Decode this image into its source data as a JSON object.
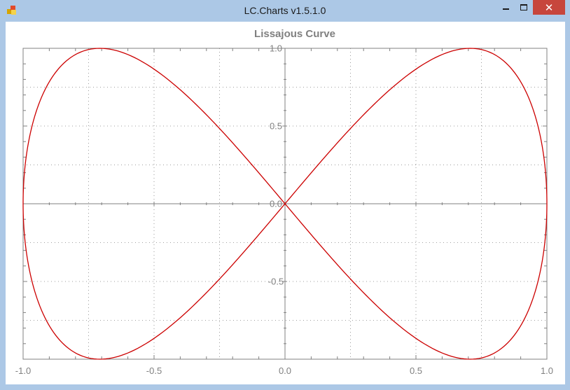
{
  "window": {
    "title": "LC.Charts v1.5.1.0",
    "icon": "app-icon",
    "controls": {
      "minimize": "minimize-icon",
      "maximize": "maximize-icon",
      "close": "close-icon"
    }
  },
  "colors": {
    "titlebar": "#acc8e6",
    "close_button": "#c7463c",
    "curve": "#cc0000",
    "axis": "#808080",
    "grid": "#808080",
    "text": "#808080"
  },
  "chart_data": {
    "type": "line",
    "title": "Lissajous Curve",
    "xlabel": "",
    "ylabel": "",
    "xlim": [
      -1.0,
      1.0
    ],
    "ylim": [
      -1.0,
      1.0
    ],
    "x_ticks": [
      "-1.0",
      "-0.5",
      "0.0",
      "0.5",
      "1.0"
    ],
    "x_tick_values": [
      -1.0,
      -0.5,
      0.0,
      0.5,
      1.0
    ],
    "y_ticks": [
      "-0.5",
      "0.0",
      "0.5",
      "1.0"
    ],
    "y_tick_values": [
      -0.5,
      0.0,
      0.5,
      1.0
    ],
    "grid": true,
    "legend": "none",
    "series": [
      {
        "curve": "x = sin(t), y = sin(2t), t from 0 to 2π",
        "x": [
          0.0,
          0.1951,
          0.3827,
          0.5556,
          0.7071,
          0.8315,
          0.9239,
          0.9808,
          1.0,
          0.9808,
          0.9239,
          0.8315,
          0.7071,
          0.5556,
          0.3827,
          0.1951,
          0.0,
          -0.1951,
          -0.3827,
          -0.5556,
          -0.7071,
          -0.8315,
          -0.9239,
          -0.9808,
          -1.0,
          -0.9808,
          -0.9239,
          -0.8315,
          -0.7071,
          -0.5556,
          -0.3827,
          -0.1951,
          0.0
        ],
        "y": [
          0.0,
          0.3827,
          0.7071,
          0.9239,
          1.0,
          0.9239,
          0.7071,
          0.3827,
          0.0,
          -0.3827,
          -0.7071,
          -0.9239,
          -1.0,
          -0.9239,
          -0.7071,
          -0.3827,
          0.0,
          0.3827,
          0.7071,
          0.9239,
          1.0,
          0.9239,
          0.7071,
          0.3827,
          0.0,
          -0.3827,
          -0.7071,
          -0.9239,
          -1.0,
          -0.9239,
          -0.7071,
          -0.3827,
          0.0
        ]
      }
    ]
  }
}
